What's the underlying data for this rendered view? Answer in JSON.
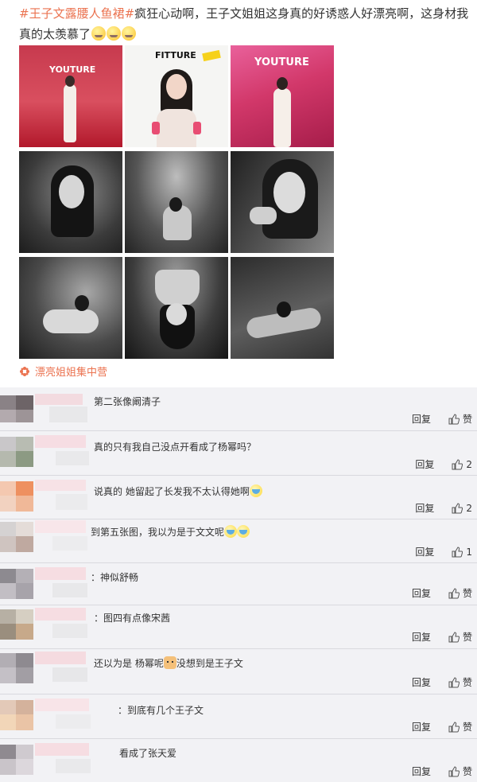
{
  "post": {
    "hashtag": "#王子文露腰人鱼裙#",
    "text": "疯狂心动啊，王子文姐姐这身真的好诱惑人好漂亮啊，这身材我真的太羡慕了",
    "emoji_count": 3,
    "photos": [
      {
        "name": "photo-red-carpet-1",
        "text": "YOUTURE"
      },
      {
        "name": "photo-fitture",
        "text": "FITTURE"
      },
      {
        "name": "photo-red-carpet-2",
        "text": "YOUTURE"
      },
      {
        "name": "photo-bw-1"
      },
      {
        "name": "photo-bw-2"
      },
      {
        "name": "photo-bw-3"
      },
      {
        "name": "photo-bw-4"
      },
      {
        "name": "photo-bw-5"
      },
      {
        "name": "photo-bw-6"
      }
    ],
    "topic": "漂亮姐姐集中营",
    "accent_color": "#eb7350"
  },
  "comments": [
    {
      "text": "第二张像阚清子",
      "reply": "回复",
      "like": "赞"
    },
    {
      "text": "真的只有我自己没点开看成了杨幂吗？",
      "reply": "回复",
      "like": "2"
    },
    {
      "text": "说真的 她留起了长发我不太认得她啊",
      "reply": "回复",
      "like": "2",
      "emoji": true
    },
    {
      "text": "到第五张图，我以为是于文文呢",
      "reply": "回复",
      "like": "1",
      "emoji": true
    },
    {
      "text": "：神似舒畅",
      "reply": "回复",
      "like": "赞"
    },
    {
      "text": "：图四有点像宋茜",
      "reply": "回复",
      "like": "赞"
    },
    {
      "text": "还以为是 杨幂呢",
      "text2": "没想到是王子文",
      "reply": "回复",
      "like": "赞"
    },
    {
      "text": "：到底有几个王子文",
      "reply": "回复",
      "like": "赞"
    },
    {
      "text": "看成了张天爱",
      "reply": "回复",
      "like": "赞"
    }
  ]
}
